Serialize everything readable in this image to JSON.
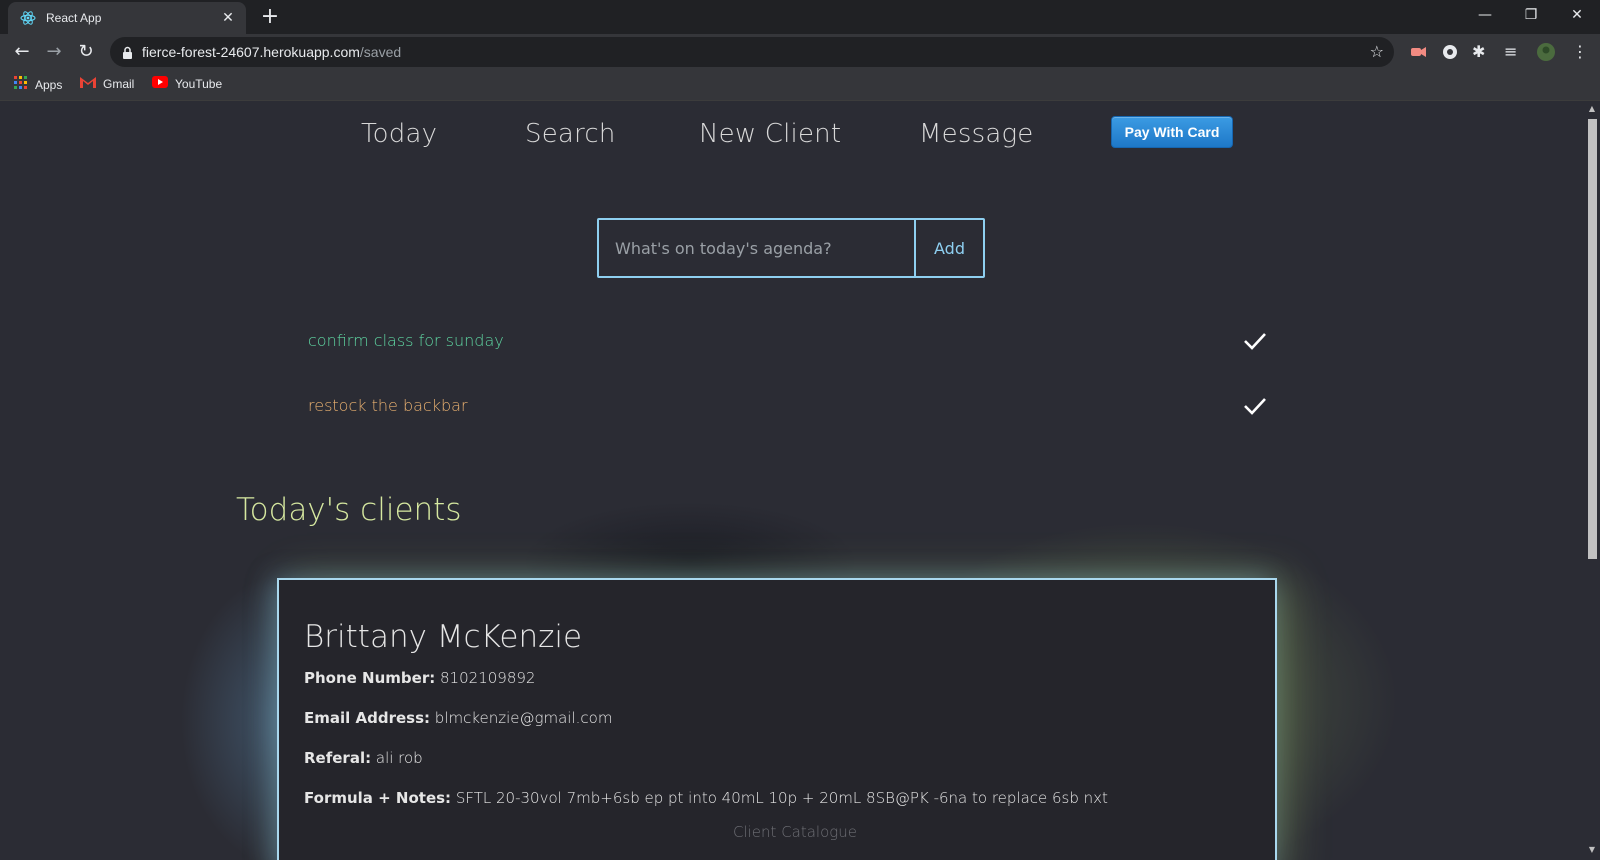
{
  "browser": {
    "tab_title": "React App",
    "url_host": "fierce-forest-24607.herokuapp.com",
    "url_path": "/saved",
    "bookmarks": [
      "Apps",
      "Gmail",
      "YouTube"
    ]
  },
  "nav": {
    "items": [
      "Today",
      "Search",
      "New Client",
      "Message"
    ],
    "pay_button": "Pay With Card"
  },
  "agenda": {
    "placeholder": "What's on today's agenda?",
    "add_label": "Add"
  },
  "todos": [
    {
      "text": "confirm class for sunday",
      "color": "#5fd6a2"
    },
    {
      "text": "restock the backbar",
      "color": "#e8b070"
    }
  ],
  "clients_heading": "Today's clients",
  "client": {
    "name": "Brittany McKenzie",
    "phone_label": "Phone Number:",
    "phone": "8102109892",
    "email_label": "Email Address:",
    "email": "blmckenzie@gmail.com",
    "referral_label": "Referal:",
    "referral": "ali rob",
    "notes_label": "Formula + Notes:",
    "notes": "SFTL 20-30vol 7mb+6sb ep pt into 40mL 10p + 20mL 8SB@PK -6na to replace 6sb nxt",
    "catalogue_label": "Client Catalogue"
  },
  "colors": {
    "accent_blue": "#8ecff0",
    "heading_green": "#d6e8a0",
    "pay_button": "#1e78c8"
  }
}
